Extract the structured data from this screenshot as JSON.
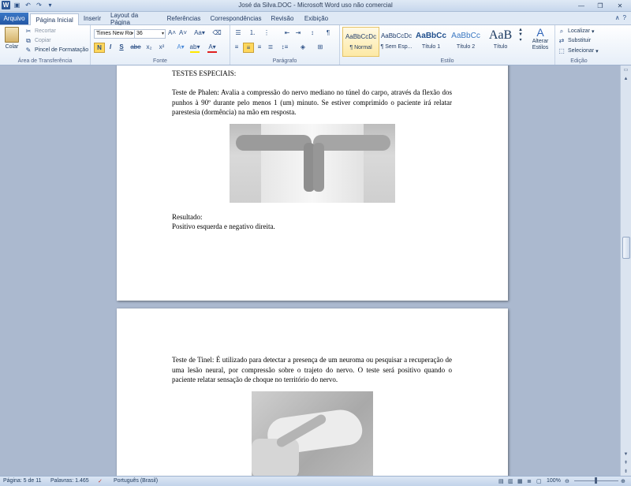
{
  "window": {
    "title": "José da Silva.DOC - Microsoft Word uso não comercial"
  },
  "tabs": [
    "Arquivo",
    "Página Inicial",
    "Inserir",
    "Layout da Página",
    "Referências",
    "Correspondências",
    "Revisão",
    "Exibição"
  ],
  "ribbon": {
    "clipboard": {
      "paste": "Colar",
      "cut": "Recortar",
      "copy": "Copiar",
      "format_painter": "Pincel de Formatação",
      "label": "Área de Transferência"
    },
    "font": {
      "family": "Times New Ro",
      "size": "36",
      "bold": "N",
      "italic": "I",
      "underline": "S",
      "strike": "abe",
      "sub": "x₂",
      "sup": "x²",
      "label": "Fonte"
    },
    "paragraph": {
      "label": "Parágrafo"
    },
    "styles": {
      "items": [
        {
          "preview": "AaBbCcDc",
          "name": "¶ Normal"
        },
        {
          "preview": "AaBbCcDc",
          "name": "¶ Sem Esp..."
        },
        {
          "preview": "AaBbCc",
          "name": "Título 1"
        },
        {
          "preview": "AaBbCc",
          "name": "Título 2"
        },
        {
          "preview": "AaB",
          "name": "Título"
        }
      ],
      "change": "Alterar Estilos",
      "label": "Estilo"
    },
    "editing": {
      "find": "Localizar",
      "replace": "Substituir",
      "select": "Selecionar",
      "label": "Edição"
    }
  },
  "document": {
    "heading": "TESTES ESPECIAIS:",
    "phalen": "Teste de Phalen: Avalia a compressão do nervo mediano no túnel do carpo, através da flexão dos punhos à 90º durante pelo menos 1 (um) minuto. Se estiver comprimido o paciente irá relatar parestesia (dormência) na mão em resposta.",
    "result_label": "Resultado:",
    "result_text": "Positivo esquerda e negativo direita.",
    "tinel": "Teste de Tinel: É utilizado para detectar a presença de um neuroma ou pesquisar a recuperação de uma lesão neural, por compressão sobre o trajeto do nervo. O teste será positivo quando o paciente relatar sensação de choque no território do nervo."
  },
  "status": {
    "page": "Página: 5 de 11",
    "words": "Palavras: 1.465",
    "language": "Português (Brasil)",
    "zoom": "100%"
  }
}
